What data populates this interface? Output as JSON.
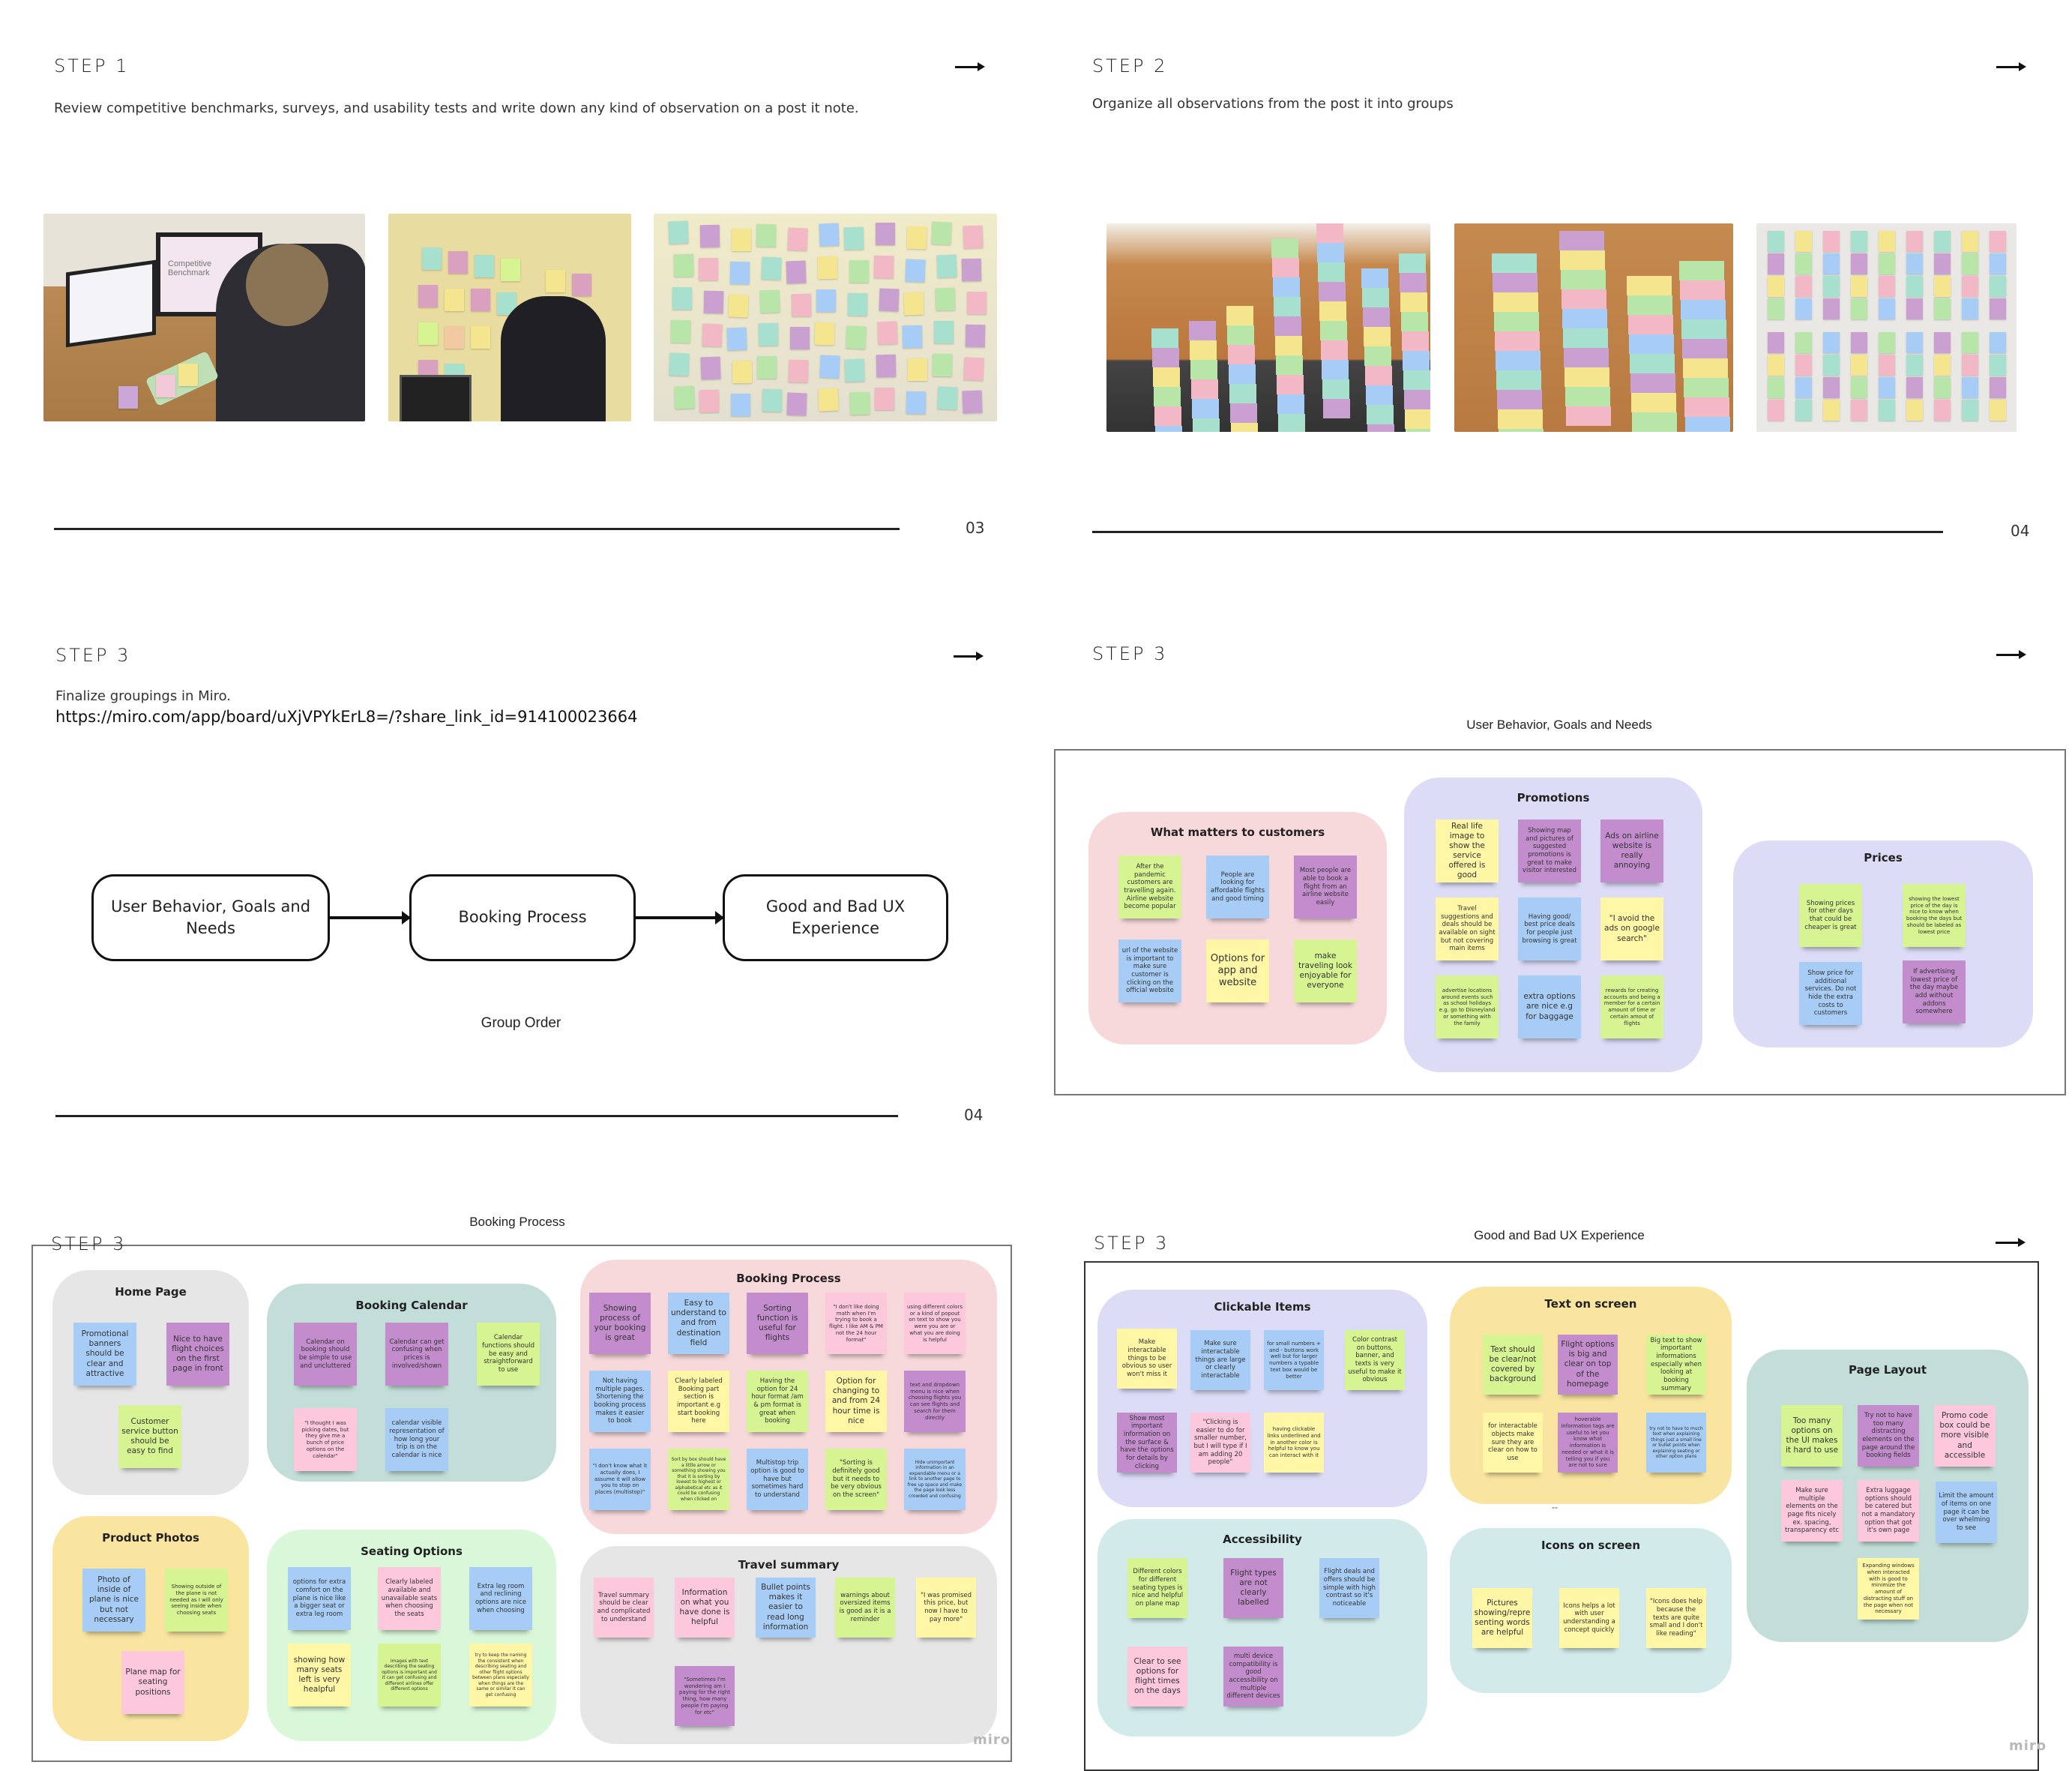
{
  "step1": {
    "title": "STEP 1",
    "description": "Review competitive benchmarks, surveys, and usability tests and write down any kind of observation on a post it note.",
    "photos": [
      "Person at desk reviewing Competitive Benchmark on monitor with sticky notes",
      "Person placing sticky notes on wall",
      "Wall covered with colorful sticky notes"
    ],
    "monitor_text": "Competitive Benchmark",
    "page_number": "03"
  },
  "step2": {
    "title": "STEP 2",
    "description": "Organize all observations from the post it into groups",
    "photos": [
      "Sticky notes arranged in strips on desk",
      "Close-up of sticky note strips",
      "Grouped sticky notes on wall"
    ],
    "page_number": "04"
  },
  "step3a": {
    "title": "STEP 3",
    "description": "Finalize groupings in Miro.",
    "url": "https://miro.com/app/board/uXjVPYkErL8=/?share_link_id=914100023664",
    "flow": [
      "User Behavior, Goals and Needs",
      "Booking Process",
      "Good and Bad UX Experience"
    ],
    "flow_caption": "Group Order",
    "page_number": "04"
  },
  "step3b": {
    "title": "STEP 3",
    "board_caption": "User Behavior, Goals and Needs",
    "clusters": [
      {
        "title": "What matters to customers",
        "notes": [
          {
            "text": "After the pandemic customers are travelling again. Airline website become popular",
            "color": "green"
          },
          {
            "text": "People are looking for affordable flights and good timing",
            "color": "blue"
          },
          {
            "text": "Most people are able to book a flight from an airline website easily",
            "color": "purple"
          },
          {
            "text": "url of the website is important to make sure customer is clicking on the official website",
            "color": "blue"
          },
          {
            "text": "Options for app and website",
            "color": "yellow"
          },
          {
            "text": "make traveling look enjoyable for everyone",
            "color": "green"
          }
        ]
      },
      {
        "title": "Promotions",
        "notes": [
          {
            "text": "Real life image to show the service offered is good",
            "color": "yellow"
          },
          {
            "text": "Showing map and pictures of suggested promotions is great to make visitor interested",
            "color": "purple"
          },
          {
            "text": "Ads on airline website is really annoying",
            "color": "purple"
          },
          {
            "text": "Travel suggestions and deals should be available on sight but not covering main items",
            "color": "yellow"
          },
          {
            "text": "Having good/ best price deals for people just browsing is great",
            "color": "blue"
          },
          {
            "text": "\"I avoid the ads on google search\"",
            "color": "yellow"
          },
          {
            "text": "advertise locations around events such as school holidays e.g. go to Disneyland or something with the family",
            "color": "green"
          },
          {
            "text": "extra options are nice e.g for baggage",
            "color": "blue"
          },
          {
            "text": "rewards for creating accounts and being a member for a certain amount of time or certain amout of flights",
            "color": "green"
          }
        ]
      },
      {
        "title": "Prices",
        "notes": [
          {
            "text": "Showing prices for other days that could be cheaper is great",
            "color": "green"
          },
          {
            "text": "showing the lowest price of the day is nice to know when booking the days but should be labeled as lowest price",
            "color": "green"
          },
          {
            "text": "Show price for additional services. Do not hide the extra costs to customers",
            "color": "blue"
          },
          {
            "text": "If advertising lowest price of the day maybe add without addons somewhere",
            "color": "purple"
          }
        ]
      }
    ],
    "arrow_icon": "arrow-right-icon"
  },
  "step3c": {
    "title": "STEP 3",
    "board_caption": "Booking Process",
    "clusters": [
      {
        "title": "Home Page",
        "notes": [
          {
            "text": "Promotional banners should be clear and attractive",
            "color": "blue"
          },
          {
            "text": "Nice to have flight choices on the first page in front",
            "color": "purple"
          },
          {
            "text": "Customer service button should be easy to find",
            "color": "green"
          }
        ]
      },
      {
        "title": "Booking Calendar",
        "notes": [
          {
            "text": "Calendar on booking should be simple to use and uncluttered",
            "color": "purple"
          },
          {
            "text": "Calendar can get confusing when prices is involved/shown",
            "color": "purple"
          },
          {
            "text": "Calendar functions should be easy and straightforward to use",
            "color": "green"
          },
          {
            "text": "\"I thought I was picking dates, but they give me a bunch of price options on the calendar\"",
            "color": "pink"
          },
          {
            "text": "calendar visible representation of how long your trip is on the calendar is nice",
            "color": "blue"
          }
        ]
      },
      {
        "title": "Booking Process",
        "notes": [
          {
            "text": "Showing process of your booking is great",
            "color": "purple"
          },
          {
            "text": "Easy to understand to and from destination field",
            "color": "blue"
          },
          {
            "text": "Sorting function is useful for flights",
            "color": "purple"
          },
          {
            "text": "\"I don't like doing math when I'm trying to book a flight. I like AM & PM not the 24 hour format\"",
            "color": "pink"
          },
          {
            "text": "using different colors or a kind of popout on text to show you were you are or what you are doing is helpful",
            "color": "pink"
          },
          {
            "text": "Not having multiple pages. Shortening the booking process makes it easier to book",
            "color": "blue"
          },
          {
            "text": "Clearly labeled Booking part section is important e.g start booking here",
            "color": "yellow"
          },
          {
            "text": "Having the option for 24 hour format /am & pm format is great when booking",
            "color": "green"
          },
          {
            "text": "Option for changing to and from 24 hour time is nice",
            "color": "yellow"
          },
          {
            "text": "text and dropdown menu is nice when choosing flights you can see flights and search for them directly",
            "color": "purple"
          },
          {
            "text": "\"I don't know what it actually does, I assume it will allow you to stop on places (multistop)\"",
            "color": "blue"
          },
          {
            "text": "Sort by box should have a little arrow or something showing you that it is sorting by lowest to highest or alphabetical etc as it could be confusing when clicked on",
            "color": "green"
          },
          {
            "text": "Multistop trip option is good to have but sometimes hard to understand",
            "color": "blue"
          },
          {
            "text": "\"Sorting is definitely good but it needs to be very obvious on the screen\"",
            "color": "green"
          },
          {
            "text": "Hide unimportant information in an expandable menu or a link to another page to free up space and make the page look less crowded and confusing",
            "color": "blue"
          }
        ]
      },
      {
        "title": "Product Photos",
        "notes": [
          {
            "text": "Photo of inside of plane is nice but not necessary",
            "color": "blue"
          },
          {
            "text": "Showing outside of the plane is not needed as I will only seeing inside when choosing seats",
            "color": "green"
          },
          {
            "text": "Plane map for seating positions",
            "color": "pink"
          }
        ]
      },
      {
        "title": "Seating Options",
        "notes": [
          {
            "text": "options for extra comfort on the plane is nice like a bigger seat or extra leg room",
            "color": "blue"
          },
          {
            "text": "Clearly labeled available and unavailable seats when choosing the seats",
            "color": "pink"
          },
          {
            "text": "Extra leg room and reclining options are nice when choosing",
            "color": "blue"
          },
          {
            "text": "showing how many seats left is very healpful",
            "color": "yellow"
          },
          {
            "text": "Images with text describing the seating options is important and it can get confusing and different airlines offer different options",
            "color": "green"
          },
          {
            "text": "try to keep the naming the consistent when describing seating and other flight options between plans especially when things are the same or similar it can get confusing",
            "color": "yellow"
          }
        ]
      },
      {
        "title": "Travel summary",
        "notes": [
          {
            "text": "Travel summary should be clear and complicated to understand",
            "color": "pink"
          },
          {
            "text": "Information on what you have done is helpful",
            "color": "pink"
          },
          {
            "text": "Bullet points makes it easier to read long information",
            "color": "blue"
          },
          {
            "text": "warnings about oversized items is good as it is a reminder",
            "color": "green"
          },
          {
            "text": "\"I was promised this price, but now I have to pay more\"",
            "color": "yellow"
          },
          {
            "text": "\"Sometimes I'm wondering am I paying for the right thing, how many people I'm paying for etc\"",
            "color": "purple"
          }
        ]
      }
    ],
    "watermark": "miro"
  },
  "step3d": {
    "title": "STEP 3",
    "board_caption": "Good and Bad UX Experience",
    "clusters": [
      {
        "title": "Clickable Items",
        "notes": [
          {
            "text": "Make interactable things to be obvious so user won't miss it",
            "color": "yellow"
          },
          {
            "text": "Make sure interactable things are large or clearly interactable",
            "color": "blue"
          },
          {
            "text": "for small numbers + and - buttons work well but for larger numbers a typable text box would be better",
            "color": "blue"
          },
          {
            "text": "Color contrast on buttons, banner, and texts is very useful to make it obvious",
            "color": "green"
          },
          {
            "text": "Show most important information on the surface & have the options for details by clicking",
            "color": "purple"
          },
          {
            "text": "\"Clicking is easier to do for smaller number, but I will type if I am adding 20 people\"",
            "color": "pink"
          },
          {
            "text": "having clickable links underlined and in another color is helpful to know you can interact with it",
            "color": "yellow"
          }
        ]
      },
      {
        "title": "Text on screen",
        "notes": [
          {
            "text": "Text should be clear/not covered by background",
            "color": "green"
          },
          {
            "text": "Flight options is big and clear on top of the homepage",
            "color": "purple"
          },
          {
            "text": "Big text to show important informations especially when looking at booking summary",
            "color": "green"
          },
          {
            "text": "for interactable objects make sure they are clear on how to use",
            "color": "yellow"
          },
          {
            "text": "hoverable information tags are useful to let you know what information is needed or what it is telling you if you are not to sure",
            "color": "purple"
          },
          {
            "text": "try not to have to much text when explaining things just a small line or bullet points when explaining seating or other option plans",
            "color": "blue"
          }
        ]
      },
      {
        "title": "Page Layout",
        "notes": [
          {
            "text": "Too many options on the UI makes it hard to use",
            "color": "green"
          },
          {
            "text": "Try not to have too many distracting elements on the page around the booking fields",
            "color": "purple"
          },
          {
            "text": "Promo code box could be more visible and accessible",
            "color": "pink"
          },
          {
            "text": "Make sure multiple elements on the page fits nicely ex. spacing, transparency etc",
            "color": "pink"
          },
          {
            "text": "Extra luggage options should be catered but not a mandatory option that got it's own page",
            "color": "pink"
          },
          {
            "text": "Limit the amount of items on one page it can be over whelming to see",
            "color": "blue"
          },
          {
            "text": "Expanding windows when interacted with is good to minimize the amount of distracting stuff on the page when not necessary",
            "color": "yellow"
          }
        ]
      },
      {
        "title": "Accessibility",
        "notes": [
          {
            "text": "Different colors for different seating types is nice and helpful on plane map",
            "color": "green"
          },
          {
            "text": "Flight types are not clearly labelled",
            "color": "purple"
          },
          {
            "text": "Flight deals and offers should be simple with high contrast so it's noticeable",
            "color": "blue"
          },
          {
            "text": "Clear to see options for flight times on the days",
            "color": "pink"
          },
          {
            "text": "multi device compatibility is good accessibility on multiple different devices",
            "color": "purple"
          }
        ]
      },
      {
        "title": "Icons on screen",
        "notes": [
          {
            "text": "Pictures showing/repre senting words are helpful",
            "color": "yellow"
          },
          {
            "text": "Icons helps a lot with user understanding a concept quickly",
            "color": "yellow"
          },
          {
            "text": "\"Icons does help because the texts are quite small and I don't like reading\"",
            "color": "yellow"
          }
        ]
      }
    ],
    "stray_mark": "--",
    "watermark": "miro"
  }
}
